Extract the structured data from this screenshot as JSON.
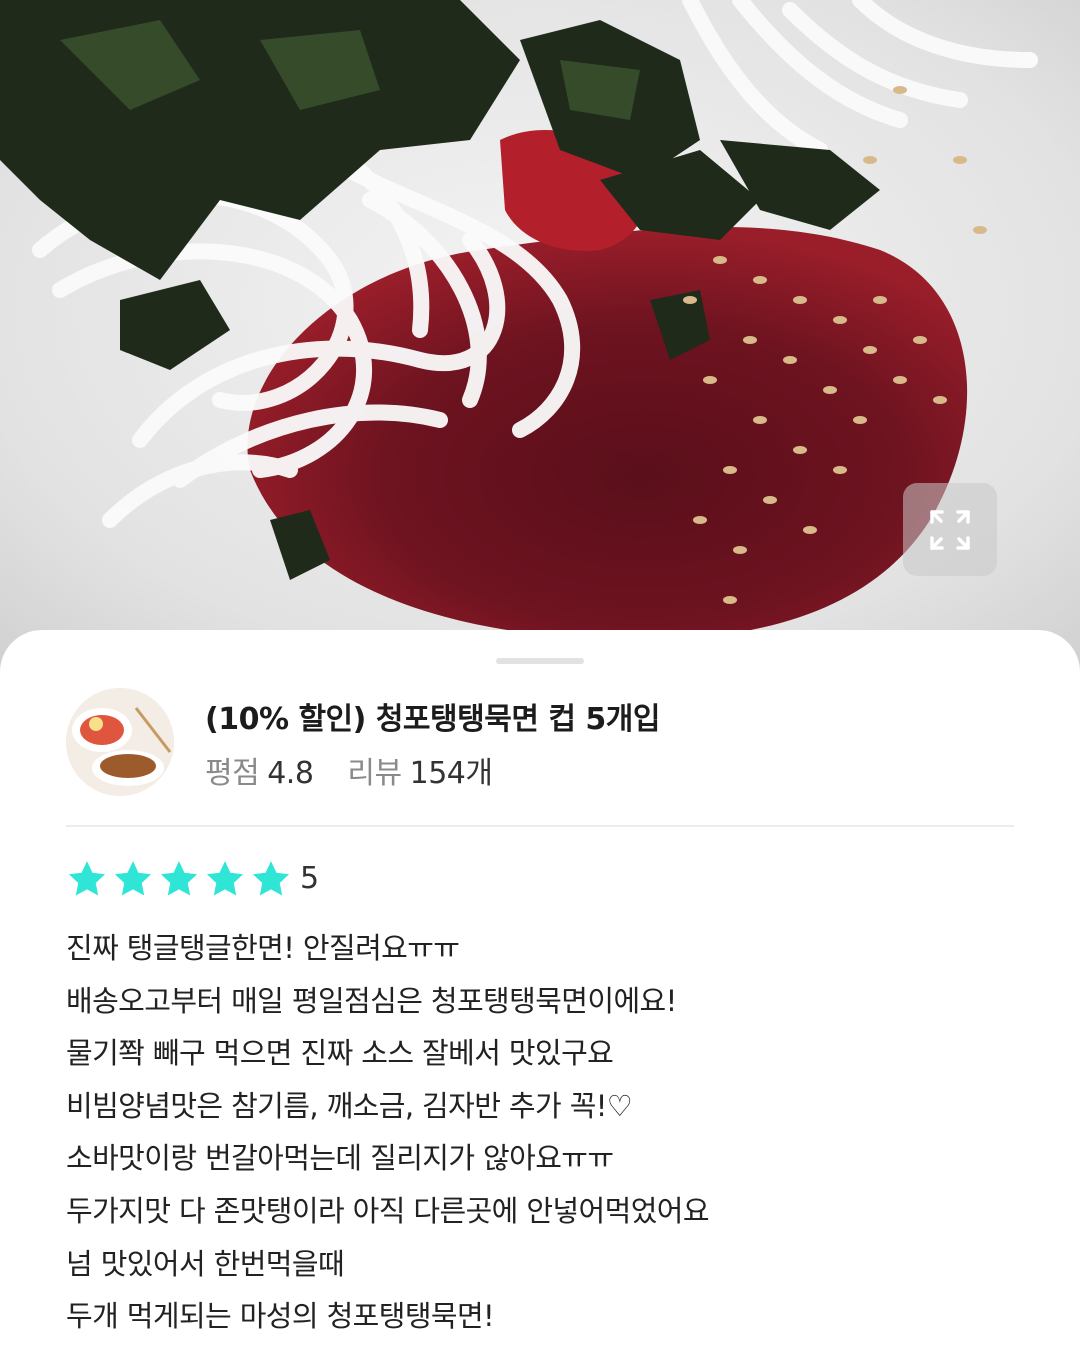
{
  "photo": {
    "expand_icon": "expand-icon"
  },
  "product": {
    "title": "(10% 할인) 청포탱탱묵면 컵 5개입",
    "rating_label": "평점",
    "rating_value": "4.8",
    "review_label": "리뷰",
    "review_count": "154개"
  },
  "review": {
    "star_color": "#2fe6d6",
    "stars": 5,
    "score": "5",
    "lines": [
      "진짜 탱글탱글한면! 안질려요ㅠㅠ",
      "배송오고부터 매일 평일점심은 청포탱탱묵면이에요!",
      "물기쫙 빼구 먹으면 진짜 소스 잘베서 맛있구요",
      "비빔양념맛은 참기름, 깨소금, 김자반 추가 꼭!♡",
      "소바맛이랑 번갈아먹는데 질리지가 않아요ㅠㅠ",
      "두가지맛 다 존맛탱이라 아직 다른곳에 안넣어먹었어요",
      "넘 맛있어서 한번먹을때",
      "두개 먹게되는 마성의 청포탱탱묵면!"
    ]
  }
}
